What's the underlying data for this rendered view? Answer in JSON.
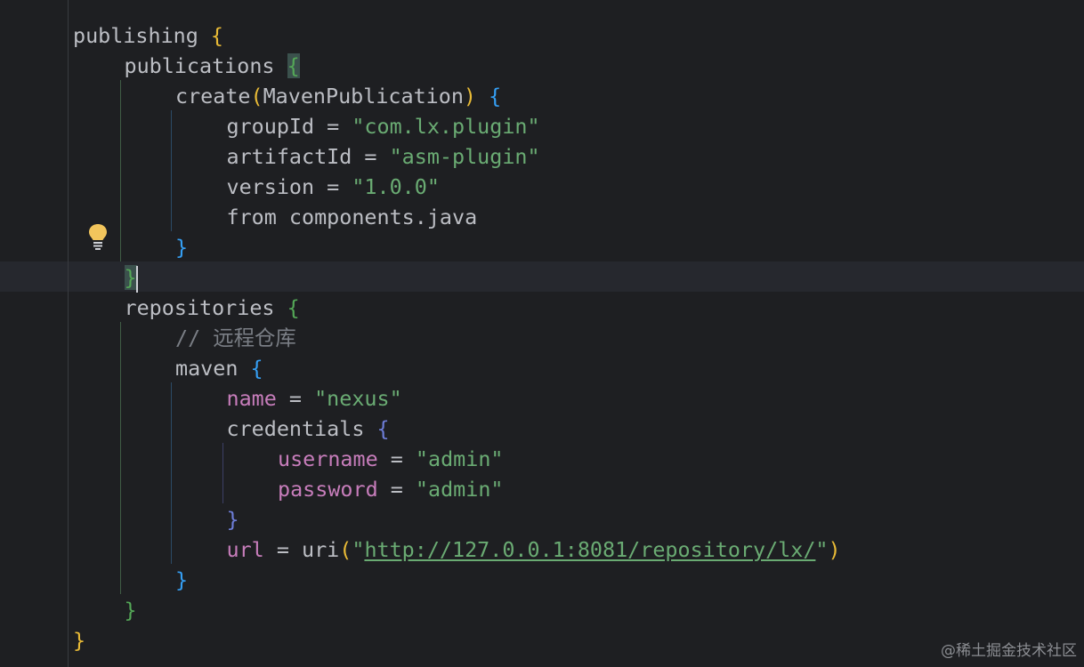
{
  "editor": {
    "language": "gradle-kotlin-dsl",
    "lines": [
      [
        {
          "t": "publishing ",
          "c": "plain"
        },
        {
          "t": "{",
          "c": "gold"
        }
      ],
      [
        {
          "t": "publications ",
          "c": "plain"
        },
        {
          "t": "{",
          "c": "green",
          "hl": true
        }
      ],
      [
        {
          "t": "create",
          "c": "plain"
        },
        {
          "t": "(",
          "c": "gold"
        },
        {
          "t": "MavenPublication",
          "c": "plain"
        },
        {
          "t": ")",
          "c": "gold"
        },
        {
          "t": " ",
          "c": "plain"
        },
        {
          "t": "{",
          "c": "blue"
        }
      ],
      [
        {
          "t": "groupId = ",
          "c": "plain"
        },
        {
          "t": "\"com.lx.plugin\"",
          "c": "str"
        }
      ],
      [
        {
          "t": "artifactId = ",
          "c": "plain"
        },
        {
          "t": "\"asm-plugin\"",
          "c": "str"
        }
      ],
      [
        {
          "t": "version = ",
          "c": "plain"
        },
        {
          "t": "\"1.0.0\"",
          "c": "str"
        }
      ],
      [
        {
          "t": "from components.java",
          "c": "plain"
        }
      ],
      [
        {
          "t": "}",
          "c": "blue"
        }
      ],
      [
        {
          "t": "}",
          "c": "green",
          "hl": true
        },
        {
          "caret": true
        }
      ],
      [
        {
          "t": "repositories ",
          "c": "plain"
        },
        {
          "t": "{",
          "c": "green"
        }
      ],
      [
        {
          "t": "// 远程仓库",
          "c": "com"
        }
      ],
      [
        {
          "t": "maven ",
          "c": "plain"
        },
        {
          "t": "{",
          "c": "blue"
        }
      ],
      [
        {
          "t": "name",
          "c": "prop"
        },
        {
          "t": " = ",
          "c": "plain"
        },
        {
          "t": "\"nexus\"",
          "c": "str"
        }
      ],
      [
        {
          "t": "credentials ",
          "c": "plain"
        },
        {
          "t": "{",
          "c": "purple"
        }
      ],
      [
        {
          "t": "username",
          "c": "prop"
        },
        {
          "t": " = ",
          "c": "plain"
        },
        {
          "t": "\"admin\"",
          "c": "str"
        }
      ],
      [
        {
          "t": "password",
          "c": "prop"
        },
        {
          "t": " = ",
          "c": "plain"
        },
        {
          "t": "\"admin\"",
          "c": "str"
        }
      ],
      [
        {
          "t": "}",
          "c": "purple"
        }
      ],
      [
        {
          "t": "url",
          "c": "prop"
        },
        {
          "t": " = uri",
          "c": "plain"
        },
        {
          "t": "(",
          "c": "gold"
        },
        {
          "t": "\"",
          "c": "str"
        },
        {
          "t": "http://127.0.0.1:8081/repository/lx/",
          "c": "link"
        },
        {
          "t": "\"",
          "c": "str"
        },
        {
          "t": ")",
          "c": "gold"
        }
      ],
      [
        {
          "t": "}",
          "c": "blue"
        }
      ],
      [
        {
          "t": "}",
          "c": "green"
        }
      ],
      [
        {
          "t": "}",
          "c": "gold"
        }
      ]
    ]
  },
  "colors": {
    "background": "#1e1f22",
    "plain": "#bcbec4",
    "string": "#6aab73",
    "property": "#c77dbb",
    "comment": "#7a7e85",
    "bracket_gold": "#e8ba36",
    "bracket_green": "#54a857",
    "bracket_blue": "#359ff4",
    "bracket_purple": "#6e7ed9"
  },
  "gutter": {
    "intention_icon": "lightbulb-icon"
  },
  "watermark": {
    "text": "@稀土掘金技术社区"
  }
}
